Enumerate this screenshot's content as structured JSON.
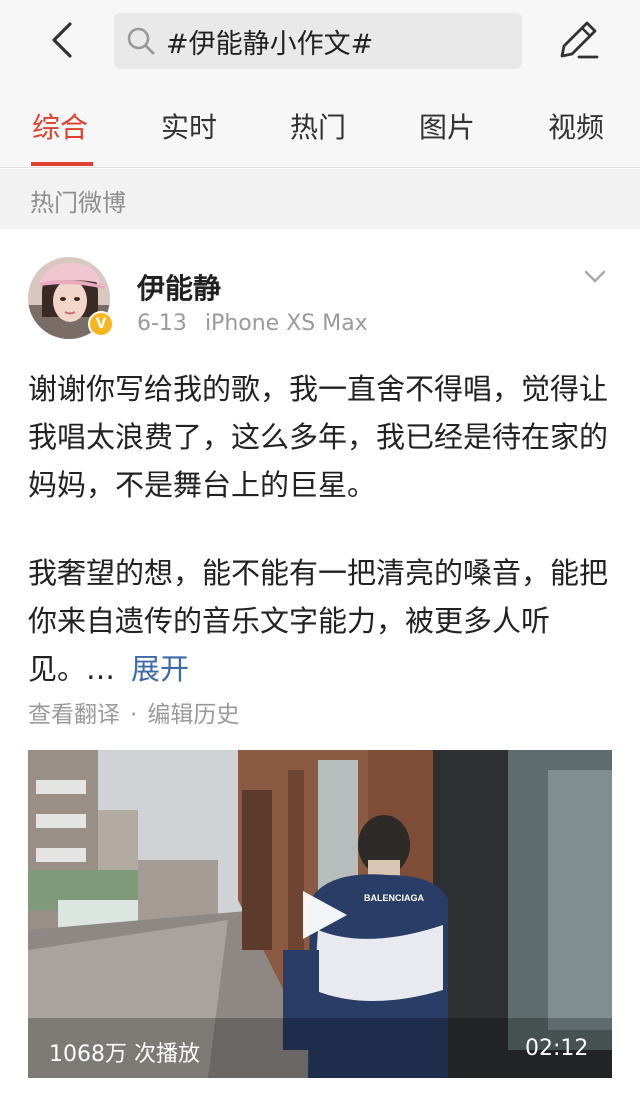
{
  "header": {
    "search_text": "#伊能静小作文#"
  },
  "tabs": [
    {
      "label": "综合",
      "active": true
    },
    {
      "label": "实时"
    },
    {
      "label": "热门"
    },
    {
      "label": "图片"
    },
    {
      "label": "视频"
    }
  ],
  "section": {
    "title": "热门微博"
  },
  "post": {
    "author": "伊能静",
    "date": "6-13",
    "device": "iPhone XS Max",
    "verified_badge": "V",
    "paragraph1": "谢谢你写给我的歌，我一直舍不得唱，觉得让我唱太浪费了，这么多年，我已经是待在家的妈妈，不是舞台上的巨星。",
    "paragraph2": "我奢望的想，能不能有一把清亮的嗓音，能把你来自遗传的音乐文字能力，被更多人听见。…",
    "expand_label": "展开",
    "translate_label": "查看翻译",
    "separator": "·",
    "history_label": "编辑历史",
    "video": {
      "views": "1068万 次播放",
      "duration": "02:12",
      "jacket_text": "BALENCIAGA"
    }
  },
  "colors": {
    "accent": "#e0402f",
    "link": "#3c6aa8",
    "badge": "#f8b51d"
  },
  "icons": [
    "back-arrow-icon",
    "search-icon",
    "edit-icon",
    "chevron-down-icon",
    "play-icon"
  ]
}
